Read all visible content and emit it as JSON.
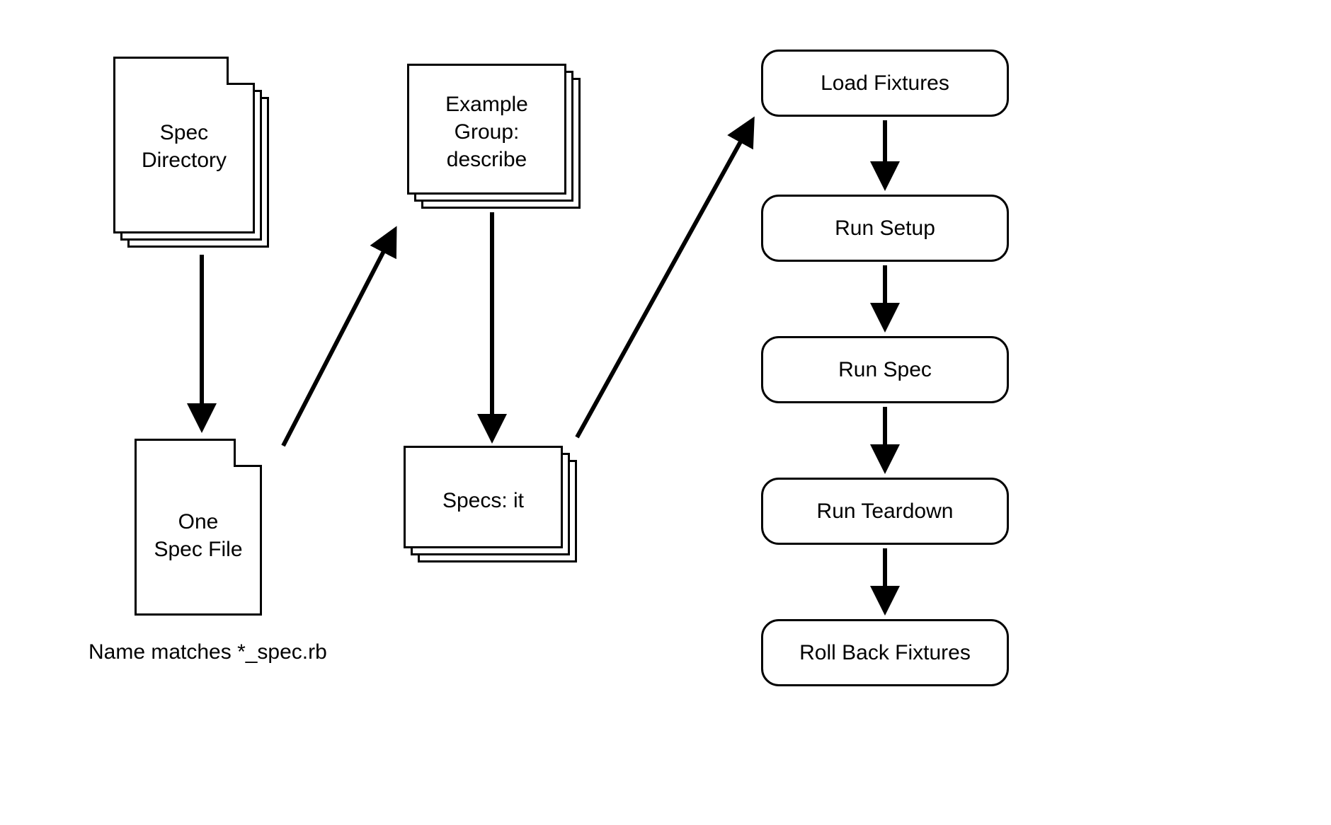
{
  "nodes": {
    "spec_directory": {
      "line1": "Spec",
      "line2": "Directory"
    },
    "one_spec_file": {
      "line1": "One",
      "line2": "Spec File"
    },
    "example_group": {
      "line1": "Example",
      "line2": "Group:",
      "line3": "describe"
    },
    "specs_it": {
      "line1": "Specs: it"
    }
  },
  "steps": {
    "load_fixtures": "Load Fixtures",
    "run_setup": "Run Setup",
    "run_spec": "Run Spec",
    "run_teardown": "Run Teardown",
    "roll_back": "Roll Back Fixtures"
  },
  "caption": "Name matches *_spec.rb"
}
